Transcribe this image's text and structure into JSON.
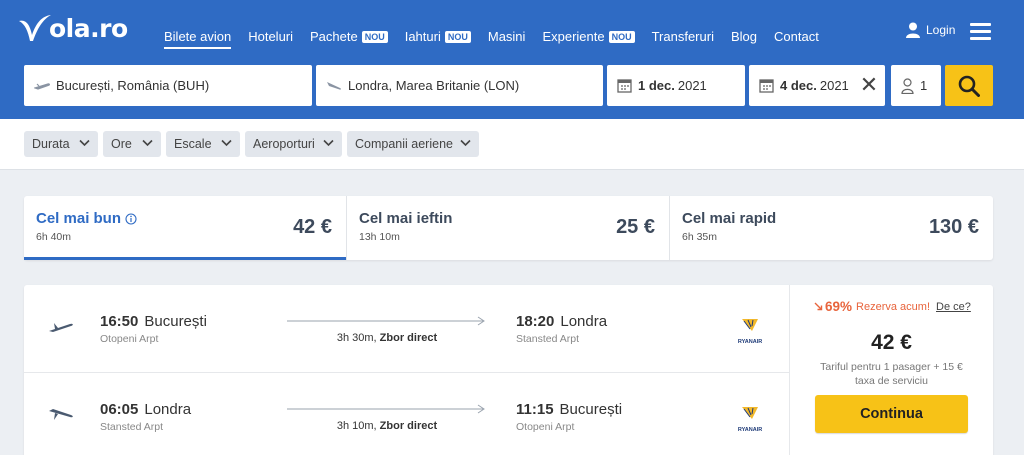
{
  "brand": {
    "logo_text": "ola.ro"
  },
  "nav": {
    "items": [
      {
        "label": "Bilete avion",
        "badge": ""
      },
      {
        "label": "Hoteluri",
        "badge": ""
      },
      {
        "label": "Pachete",
        "badge": "NOU"
      },
      {
        "label": "Iahturi",
        "badge": "NOU"
      },
      {
        "label": "Masini",
        "badge": ""
      },
      {
        "label": "Experiente",
        "badge": "NOU"
      },
      {
        "label": "Transferuri",
        "badge": ""
      },
      {
        "label": "Blog",
        "badge": ""
      },
      {
        "label": "Contact",
        "badge": ""
      }
    ],
    "login": "Login"
  },
  "search": {
    "from": "București, România (BUH)",
    "to": "Londra, Marea Britanie (LON)",
    "depart_day": "1 dec.",
    "depart_year": "2021",
    "return_day": "4 dec.",
    "return_year": "2021",
    "passengers": "1"
  },
  "filters": [
    "Durata",
    "Ore",
    "Escale",
    "Aeroporturi",
    "Companii aeriene"
  ],
  "sort_tabs": [
    {
      "title": "Cel mai bun",
      "duration": "6h 40m",
      "price": "42 €",
      "active": true
    },
    {
      "title": "Cel mai ieftin",
      "duration": "13h 10m",
      "price": "25 €",
      "active": false
    },
    {
      "title": "Cel mai rapid",
      "duration": "6h 35m",
      "price": "130 €",
      "active": false
    }
  ],
  "result": {
    "legs": [
      {
        "dep_time": "16:50",
        "dep_city": "București",
        "dep_airport": "Otopeni Arpt",
        "duration": "3h 30m,",
        "stops": "Zbor direct",
        "arr_time": "18:20",
        "arr_city": "Londra",
        "arr_airport": "Stansted Arpt",
        "airline": "RYANAIR"
      },
      {
        "dep_time": "06:05",
        "dep_city": "Londra",
        "dep_airport": "Stansted Arpt",
        "duration": "3h 10m,",
        "stops": "Zbor direct",
        "arr_time": "11:15",
        "arr_city": "București",
        "arr_airport": "Otopeni Arpt",
        "airline": "RYANAIR"
      }
    ],
    "promo_percent": "69%",
    "promo_text": "Rezerva acum!",
    "promo_link": "De ce?",
    "price": "42 €",
    "fee_text": "Tariful pentru 1 pasager + 15 € taxa de serviciu",
    "cta": "Continua"
  },
  "colors": {
    "brand_blue": "#2f6bc4",
    "accent_yellow": "#f7c217",
    "promo_orange": "#e8643c"
  }
}
